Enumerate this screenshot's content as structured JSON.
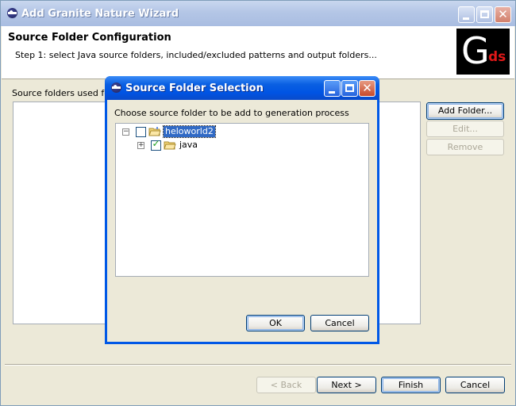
{
  "window": {
    "title": "Add Granite Nature Wizard"
  },
  "header": {
    "title": "Source Folder Configuration",
    "description": "Step 1: select Java source folders, included/excluded patterns and output folders...",
    "logo_main": "G",
    "logo_sub": "ds"
  },
  "main": {
    "folders_label": "Source folders used for g",
    "buttons": {
      "add_folder": "Add Folder...",
      "edit": "Edit...",
      "remove": "Remove"
    }
  },
  "footer": {
    "back": "< Back",
    "next": "Next >",
    "finish": "Finish",
    "cancel": "Cancel"
  },
  "dialog": {
    "title": "Source Folder Selection",
    "instruction": "Choose source folder to be add to generation process",
    "tree": [
      {
        "label": "heloworld2",
        "expander": "⊟",
        "checked": false,
        "selected": true
      },
      {
        "label": "java",
        "expander": "⊞",
        "checked": true,
        "selected": false
      }
    ],
    "ok": "OK",
    "cancel": "Cancel"
  },
  "colors": {
    "accent": "#0054e3",
    "selection": "#316ac5",
    "logo_red": "#e01818"
  }
}
